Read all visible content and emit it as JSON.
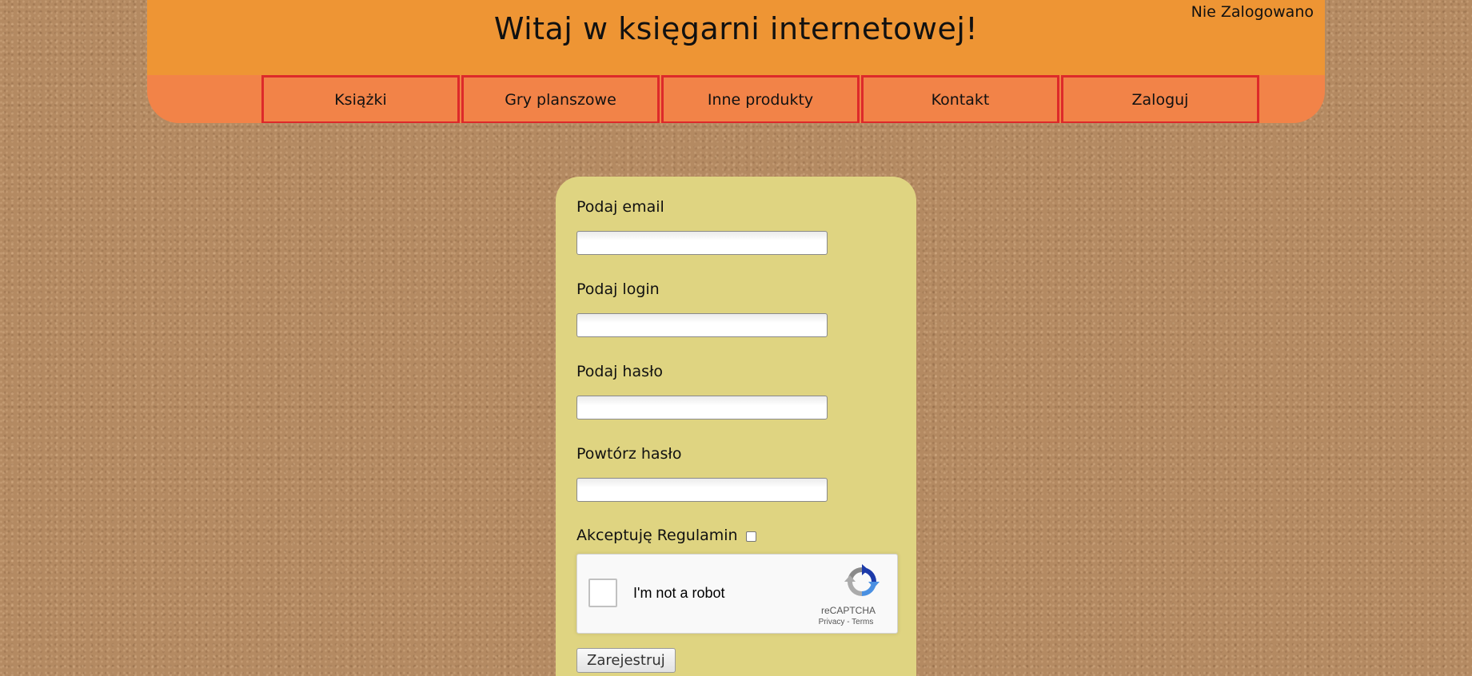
{
  "header": {
    "title": "Witaj w księgarni internetowej!",
    "login_status": "Nie Zalogowano"
  },
  "nav": {
    "items": [
      {
        "label": "Książki"
      },
      {
        "label": "Gry planszowe"
      },
      {
        "label": "Inne produkty"
      },
      {
        "label": "Kontakt"
      },
      {
        "label": "Zaloguj"
      }
    ]
  },
  "form": {
    "email_label": "Podaj email",
    "email_value": "",
    "login_label": "Podaj login",
    "login_value": "",
    "password_label": "Podaj hasło",
    "password_value": "",
    "repeat_password_label": "Powtórz hasło",
    "repeat_password_value": "",
    "accept_label": "Akceptuję Regulamin",
    "accept_checked": false,
    "submit_label": "Zarejestruj"
  },
  "recaptcha": {
    "label": "I'm not a robot",
    "brand": "reCAPTCHA",
    "privacy": "Privacy",
    "separator": " - ",
    "terms": "Terms",
    "logo_icon": "recaptcha-logo-icon"
  },
  "colors": {
    "header_top": "#ee9534",
    "header_bottom": "#f28348",
    "nav_border": "#dd2a2a",
    "form_panel": "#dfd481",
    "background": "#b48a62"
  }
}
